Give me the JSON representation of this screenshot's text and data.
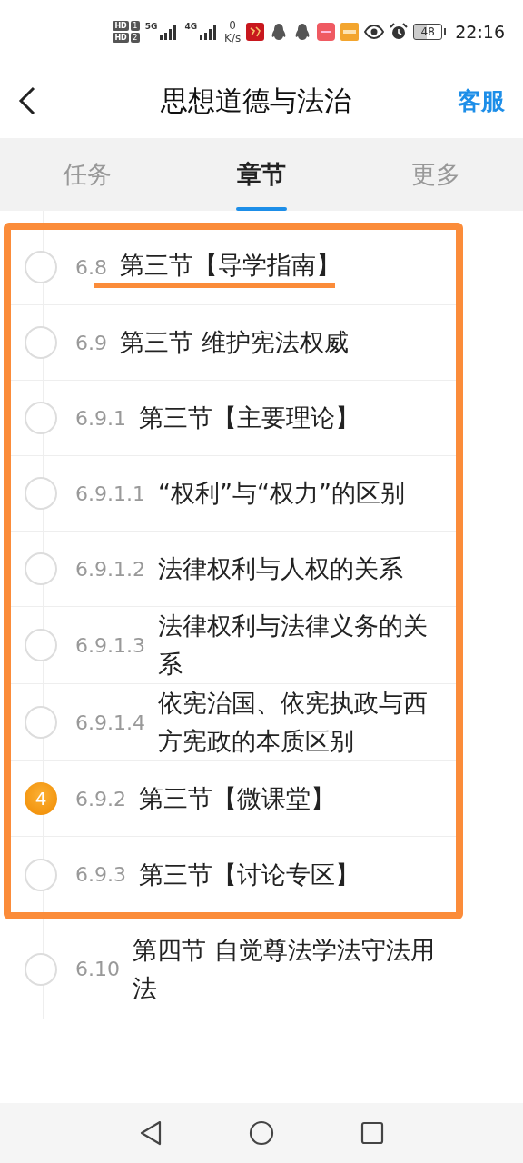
{
  "status_bar": {
    "sim_labels": [
      "HD",
      "HD"
    ],
    "sim_numbers": [
      "1",
      "2"
    ],
    "networks": [
      "5G",
      "4G"
    ],
    "speed_value": "0",
    "speed_unit": "K/s",
    "battery": "48",
    "time": "22:16"
  },
  "header": {
    "title": "思想道德与法治",
    "action": "客服"
  },
  "tabs": [
    {
      "label": "任务",
      "selected": false
    },
    {
      "label": "章节",
      "selected": true
    },
    {
      "label": "更多",
      "selected": false
    }
  ],
  "chapters": [
    {
      "number": "6.8",
      "title": "第三节【导学指南】",
      "highlighted": true,
      "underlined": true
    },
    {
      "number": "6.9",
      "title": "第三节 维护宪法权威",
      "highlighted": true,
      "underlined": false
    },
    {
      "number": "6.9.1",
      "title": "第三节【主要理论】",
      "highlighted": true,
      "underlined": false
    },
    {
      "number": "6.9.1.1",
      "title": "“权利”与“权力”的区别",
      "highlighted": true,
      "underlined": false
    },
    {
      "number": "6.9.1.2",
      "title": "法律权利与人权的关系",
      "highlighted": true,
      "underlined": false
    },
    {
      "number": "6.9.1.3",
      "title": "法律权利与法律义务的关系",
      "highlighted": true,
      "underlined": false
    },
    {
      "number": "6.9.1.4",
      "title": "依宪治国、依宪执政与西方宪政的本质区别",
      "highlighted": true,
      "underlined": false
    },
    {
      "number": "6.9.2",
      "title": "第三节【微课堂】",
      "highlighted": true,
      "underlined": false,
      "badge": "4"
    },
    {
      "number": "6.9.3",
      "title": "第三节【讨论专区】",
      "highlighted": true,
      "underlined": false
    },
    {
      "number": "6.10",
      "title": "第四节 自觉尊法学法守法用法",
      "highlighted": false,
      "underlined": false
    }
  ]
}
